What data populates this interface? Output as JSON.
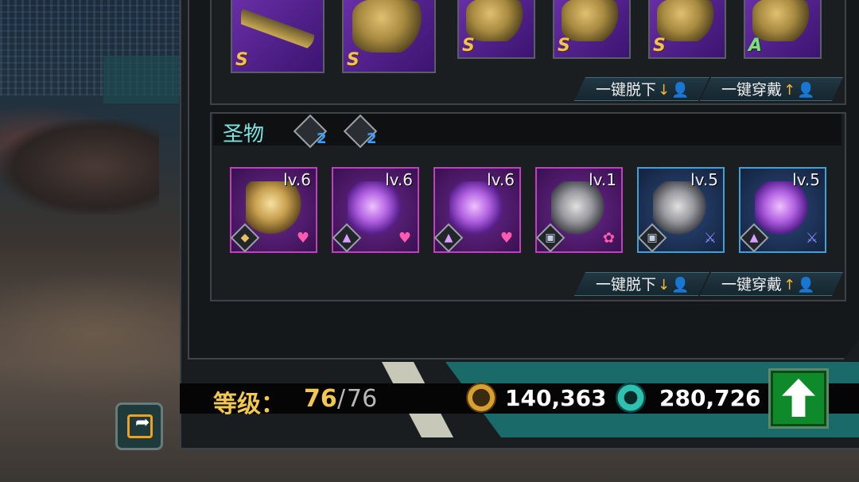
{
  "equipment": {
    "slots": [
      {
        "grade": "S",
        "icon": "machine-gun-icon"
      },
      {
        "grade": "S",
        "icon": "grenade-icon"
      },
      {
        "grade": "S",
        "icon": "helmet-icon"
      },
      {
        "grade": "S",
        "icon": "vest-icon"
      },
      {
        "grade": "S",
        "icon": "boots-icon"
      },
      {
        "grade": "A",
        "icon": "backpack-icon"
      }
    ],
    "unequip_all_label": "一键脱下",
    "equip_all_label": "一键穿戴"
  },
  "relics": {
    "title": "圣物",
    "set_bonuses": [
      {
        "icon": "star-crystal-set-icon",
        "count": "2"
      },
      {
        "icon": "gear-set-icon",
        "count": "2"
      }
    ],
    "items": [
      {
        "level": "lv.6",
        "rarity_color": "#c040c0",
        "set_icon": "gold-rune-set-icon",
        "tag_icon": "heart-icon"
      },
      {
        "level": "lv.6",
        "rarity_color": "#c040c0",
        "set_icon": "star-crystal-set-icon",
        "tag_icon": "heart-icon"
      },
      {
        "level": "lv.6",
        "rarity_color": "#c040c0",
        "set_icon": "star-crystal-set-icon",
        "tag_icon": "heart-icon"
      },
      {
        "level": "lv.1",
        "rarity_color": "#c040c0",
        "set_icon": "gear-set-icon",
        "tag_icon": "paw-icon"
      },
      {
        "level": "lv.5",
        "rarity_color": "#40a0d8",
        "set_icon": "gear-set-icon",
        "tag_icon": "sword-icon"
      },
      {
        "level": "lv.5",
        "rarity_color": "#40a0d8",
        "set_icon": "star-crystal-set-icon",
        "tag_icon": "sword-icon"
      }
    ],
    "unequip_all_label": "一键脱下",
    "equip_all_label": "一键穿戴"
  },
  "status": {
    "level_label": "等级：",
    "level_current": "76",
    "level_separator": "/",
    "level_max": "76",
    "gold": "140,363",
    "credits": "280,726"
  },
  "colors": {
    "accent_teal": "#1a6a6a",
    "gold_text": "#f2c84e",
    "purple_rarity": "#c040c0",
    "blue_rarity": "#40a0d8",
    "upgrade_green": "#0f8a2a"
  }
}
